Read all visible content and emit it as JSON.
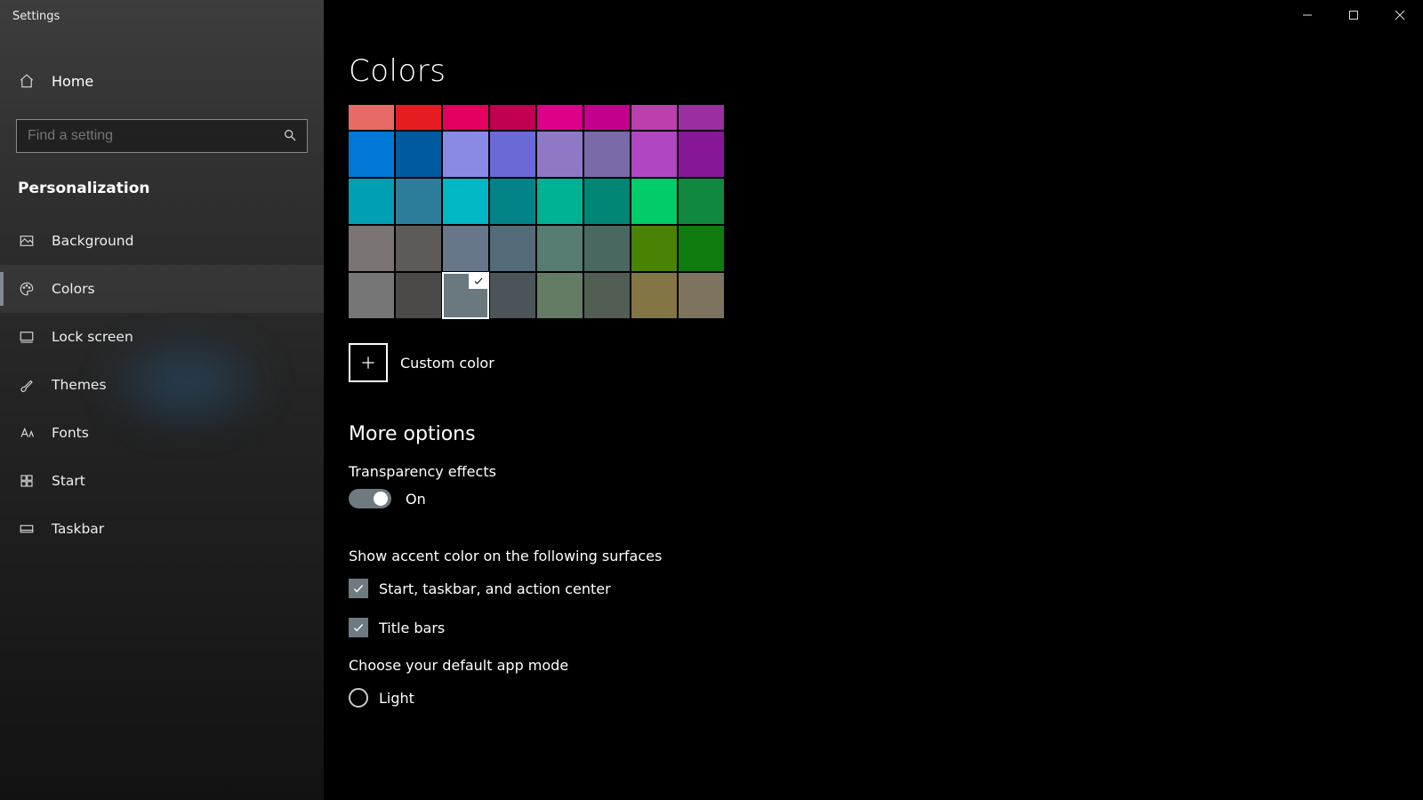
{
  "window": {
    "title": "Settings"
  },
  "sidebar": {
    "home_label": "Home",
    "search_placeholder": "Find a setting",
    "section_title": "Personalization",
    "items": [
      {
        "label": "Background"
      },
      {
        "label": "Colors"
      },
      {
        "label": "Lock screen"
      },
      {
        "label": "Themes"
      },
      {
        "label": "Fonts"
      },
      {
        "label": "Start"
      },
      {
        "label": "Taskbar"
      }
    ]
  },
  "page": {
    "title": "Colors",
    "custom_color_label": "Custom color",
    "more_options_heading": "More options",
    "transparency_label": "Transparency effects",
    "transparency_state": "On",
    "accent_surfaces_label": "Show accent color on the following surfaces",
    "surface_start_label": "Start, taskbar, and action center",
    "surface_titlebars_label": "Title bars",
    "default_mode_label": "Choose your default app mode",
    "mode_light_label": "Light"
  },
  "colors": {
    "row0": [
      "#e86a64",
      "#e71c23",
      "#e3005e",
      "#c10052",
      "#de0089",
      "#c1008c",
      "#bb3fac",
      "#9b2fa1"
    ],
    "row1": [
      "#0078d7",
      "#005a9e",
      "#8a8ae6",
      "#6b69d6",
      "#8f79c7",
      "#7b6aa8",
      "#b146c2",
      "#881798"
    ],
    "row2": [
      "#009fb3",
      "#2d7d9a",
      "#00b7c3",
      "#038387",
      "#00b294",
      "#018574",
      "#00cc6a",
      "#10893e"
    ],
    "row3": [
      "#7a7574",
      "#5d5a58",
      "#68768a",
      "#546b7a",
      "#567c73",
      "#486860",
      "#498205",
      "#107c10"
    ],
    "row4": [
      "#767676",
      "#4c4a48",
      "#69797e",
      "#4a5459",
      "#647c64",
      "#525e54",
      "#847545",
      "#7e735f"
    ],
    "selected_row": 4,
    "selected_col": 2
  }
}
